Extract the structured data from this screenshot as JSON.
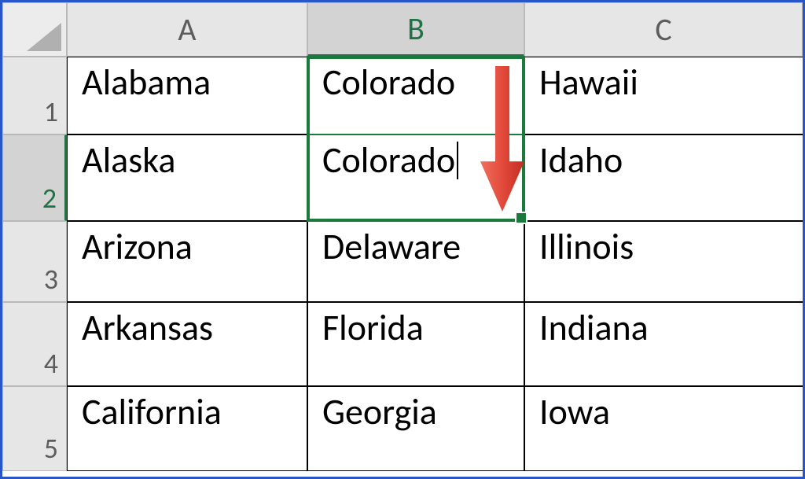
{
  "columns": {
    "A": "A",
    "B": "B",
    "C": "C"
  },
  "rows": {
    "1": "1",
    "2": "2",
    "3": "3",
    "4": "4",
    "5": "5"
  },
  "cells": {
    "A": [
      "Alabama",
      "Alaska",
      "Arizona",
      "Arkansas",
      "California"
    ],
    "B": [
      "Colorado",
      "Colorado",
      "Delaware",
      "Florida",
      "Georgia"
    ],
    "C": [
      "Hawaii",
      "Idaho",
      "Illinois",
      "Indiana",
      "Iowa"
    ]
  },
  "selection": {
    "range": "B1:B2",
    "editing_cell": "B2",
    "editing_value": "Colorado"
  },
  "annotation": {
    "type": "down-arrow",
    "color": "#e24a3b"
  }
}
